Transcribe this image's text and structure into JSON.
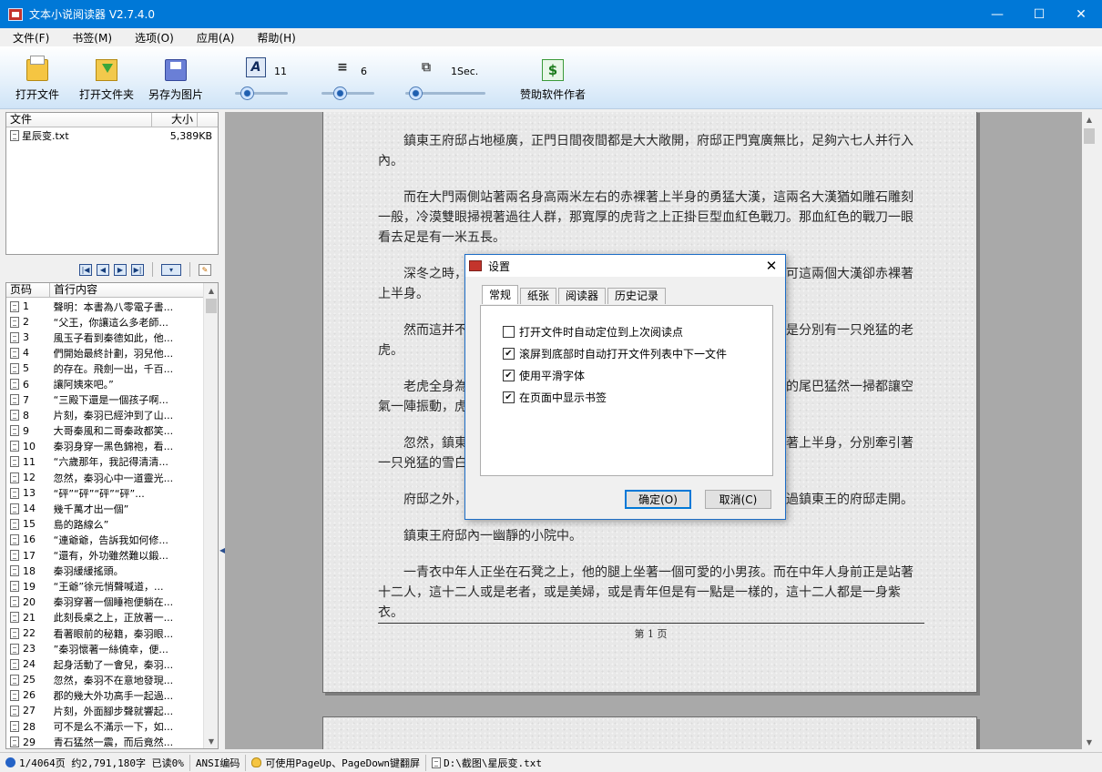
{
  "window": {
    "title": "文本小说阅读器 V2.7.4.0",
    "minimize_icon": "minimize-icon",
    "maximize_icon": "maximize-icon",
    "close_icon": "close-icon"
  },
  "menu": [
    "文件(F)",
    "书签(M)",
    "选项(O)",
    "应用(A)",
    "帮助(H)"
  ],
  "toolbar": {
    "open_file": "打开文件",
    "open_folder": "打开文件夹",
    "save_as_image": "另存为图片",
    "sponsor": "赞助软件作者",
    "font_size": {
      "icon": "A",
      "value": "11",
      "level": 0.15
    },
    "line_spacing": {
      "icon": "≡",
      "value": "6",
      "level": 0.3
    },
    "page_timer": {
      "icon": "⧉",
      "value": "1Sec.",
      "level": 0.05
    }
  },
  "file_list": {
    "headers": [
      "文件",
      "大小"
    ],
    "rows": [
      {
        "name": "星辰变.txt",
        "size": "5,389KB"
      }
    ]
  },
  "bookmark_list": {
    "headers": [
      "页码",
      "首行内容"
    ],
    "rows": [
      {
        "page": "1",
        "text": "聲明：本書為八零電子書..."
      },
      {
        "page": "2",
        "text": "“父王，你讓這么多老師..."
      },
      {
        "page": "3",
        "text": "風玉子看到秦德如此，他..."
      },
      {
        "page": "4",
        "text": "們開始最終計劃，羽兒他..."
      },
      {
        "page": "5",
        "text": "的存在。飛劍一出，千百..."
      },
      {
        "page": "6",
        "text": "讓阿姨來吧。”"
      },
      {
        "page": "7",
        "text": "“三殿下還是一個孩子啊..."
      },
      {
        "page": "8",
        "text": "片刻，秦羽已經沖到了山..."
      },
      {
        "page": "9",
        "text": "大哥秦風和二哥秦政都笑..."
      },
      {
        "page": "10",
        "text": "秦羽身穿一黑色錦袍，看..."
      },
      {
        "page": "11",
        "text": "“六歲那年，我記得清清..."
      },
      {
        "page": "12",
        "text": "忽然，秦羽心中一道靈光..."
      },
      {
        "page": "13",
        "text": "“砰”“砰”“砰”“砰”..."
      },
      {
        "page": "14",
        "text": "幾千萬才出一個”"
      },
      {
        "page": "15",
        "text": "島的路線么”"
      },
      {
        "page": "16",
        "text": "“連爺爺，告訴我如何修..."
      },
      {
        "page": "17",
        "text": "“還有，外功雖然難以鍛..."
      },
      {
        "page": "18",
        "text": "秦羽緩緩搖頭。"
      },
      {
        "page": "19",
        "text": "“王爺”徐元悄聲喊道，..."
      },
      {
        "page": "20",
        "text": "秦羽穿著一個睡袍便躺在..."
      },
      {
        "page": "21",
        "text": "此刻長桌之上，正放著一..."
      },
      {
        "page": "22",
        "text": "看著眼前的秘籍，秦羽眼..."
      },
      {
        "page": "23",
        "text": "”秦羽懷著一絲僥幸，便..."
      },
      {
        "page": "24",
        "text": "起身活動了一會兒，秦羽..."
      },
      {
        "page": "25",
        "text": "忽然，秦羽不在意地發現..."
      },
      {
        "page": "26",
        "text": "郡的幾大外功高手一起過..."
      },
      {
        "page": "27",
        "text": "片刻，外面腳步聲就響起..."
      },
      {
        "page": "28",
        "text": "可不是么不滿示一下，如..."
      },
      {
        "page": "29",
        "text": "青石猛然一震，而后竟然..."
      }
    ]
  },
  "reader": {
    "paragraphs": [
      "鎮東王府邸占地極廣，正門日間夜間都是大大敞開，府邸正門寬廣無比，足夠六七人并行入內。",
      "而在大門兩側站著兩名身高兩米左右的赤裸著上半身的勇猛大漢，這兩名大漢猶如雕石雕刻一般，冷漠雙眼掃視著過往人群，那寬厚的虎背之上正掛巨型血紅色戰刀。那血紅色的戰刀一眼看去足是有一米五長。",
      "深冬之時，嚴寒刺骨，寒風凜冽如刀，陣陣寒風刮過鎮東王府大門，可這兩個大漢卻赤裸著上半身。",
      "然而這并不是最吸引人的，在這兩個大漢之間，還有一件事物，那就是分別有一只兇猛的老虎。",
      "老虎全身為火紅色，身長約三米，安靜的趴在那里，只是偶爾那粗大的尾巴猛然一掃都讓空氣一陣振動，虎目開闔之間，卻是兇光四射。",
      "忽然，鎮東王府邸門口走出來兩個同樣高大的壯漢，同樣的也是赤裸著上半身，分別牽引著一只兇猛的雪白色老虎。",
      "府邸之外，行人看到這一幕，都是敬畏的看了一眼，隨即都遠遠的繞過鎮東王的府邸走開。",
      "鎮東王府邸內一幽靜的小院中。",
      "一青衣中年人正坐在石凳之上，他的腿上坐著一個可愛的小男孩。而在中年人身前正是站著十二人，這十二人或是老者，或是美婦，或是青年但是有一點是一樣的，這十二人都是一身紫衣。"
    ],
    "page_label": "第 1 页"
  },
  "settings_dialog": {
    "title": "设置",
    "tabs": [
      "常规",
      "纸张",
      "阅读器",
      "历史记录"
    ],
    "active_tab": "常规",
    "options": [
      {
        "label": "打开文件时自动定位到上次阅读点",
        "checked": false
      },
      {
        "label": "滚屏到底部时自动打开文件列表中下一文件",
        "checked": true
      },
      {
        "label": "使用平滑字体",
        "checked": true
      },
      {
        "label": "在页面中显示书签",
        "checked": true
      }
    ],
    "ok_label": "确定(O)",
    "cancel_label": "取消(C)"
  },
  "status": {
    "progress": "1/4064页 约2,791,180字 已读0%",
    "encoding": "ANSI编码",
    "tip": "可使用PageUp、PageDown键翻屏",
    "path": "D:\\截图\\星辰变.txt"
  }
}
